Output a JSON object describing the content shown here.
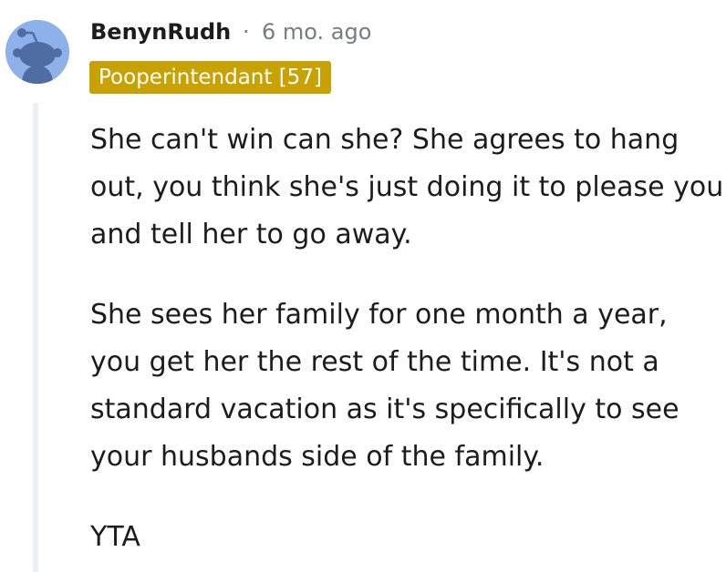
{
  "comment": {
    "author": "BenynRudh",
    "separator": "·",
    "timestamp": "6 mo. ago",
    "flair": "Pooperintendant [57]",
    "paragraphs": [
      "She can't win can she? She agrees to hang out, you think she's just doing it to please you and tell her to go away.",
      "She sees her family for one month a year, you get her the rest of the time. It's not a standard vacation as it's specifically to see your husbands side of the family.",
      "YTA"
    ]
  },
  "colors": {
    "avatar_bg": "#8fb1e9",
    "flair_bg": "#c8a103",
    "meta_text": "#787c7e",
    "thread_line": "#edeff1"
  },
  "icons": {
    "avatar": "snoo-avatar-icon"
  }
}
